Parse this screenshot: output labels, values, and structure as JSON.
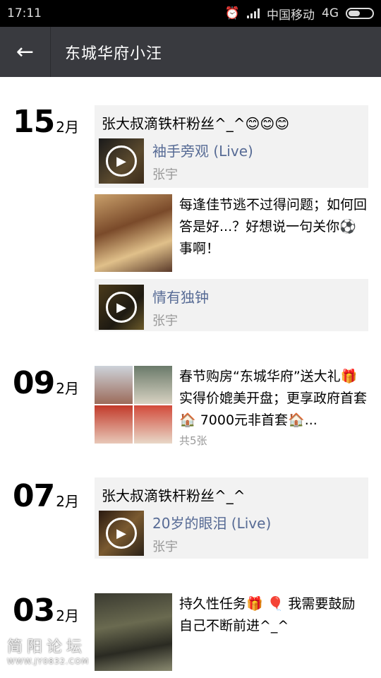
{
  "status": {
    "time": "17:11",
    "carrier": "中国移动",
    "network": "4G"
  },
  "header": {
    "back_icon": "arrow-left-icon",
    "title": "东城华府小汪"
  },
  "posts": [
    {
      "day": "15",
      "month": "2月",
      "text": "张大叔滴铁杆粉丝^_^😊😊😊",
      "media": {
        "title": "袖手旁观 (Live)",
        "artist": "张宇"
      }
    },
    {
      "photo_text": "每逢佳节逃不过得问题；如何回答是好...？好想说一句关你⚽事啊！"
    },
    {
      "media": {
        "title": "情有独钟",
        "artist": "张宇"
      }
    },
    {
      "day": "09",
      "month": "2月",
      "text": "春节购房“东城华府”送大礼🎁实得价媲美开盘；更享政府首套🏠 7000元非首套🏠...",
      "photo_count": "共5张"
    },
    {
      "day": "07",
      "month": "2月",
      "text": "张大叔滴铁杆粉丝^_^",
      "media": {
        "title": "20岁的眼泪 (Live)",
        "artist": "张宇"
      }
    },
    {
      "day": "03",
      "month": "2月",
      "text": "持久性任务🎁 🎈 我需要鼓励自己不断前进^_^"
    }
  ],
  "watermark": {
    "name": "简阳论坛",
    "url": "WWW.JY0832.COM"
  }
}
